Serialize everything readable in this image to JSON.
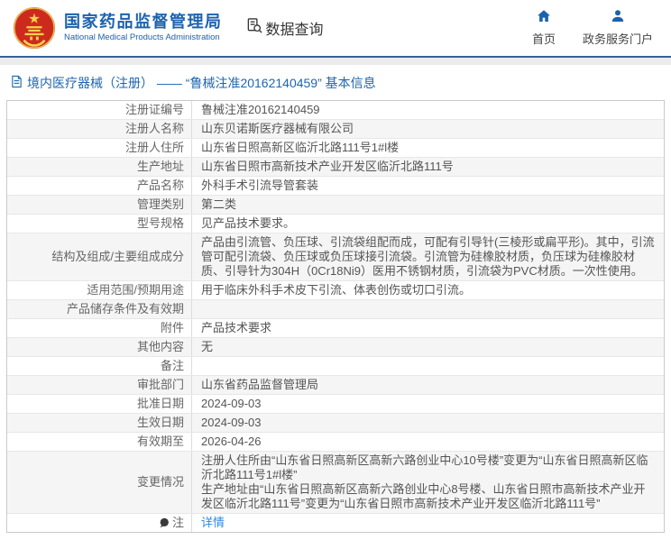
{
  "header": {
    "title_cn": "国家药品监督管理局",
    "title_en": "National Medical Products Administration",
    "data_query_label": "数据查询",
    "nav": [
      {
        "label": "首页",
        "icon": "home-icon"
      },
      {
        "label": "政务服务门户",
        "icon": "user-icon"
      }
    ]
  },
  "breadcrumb": {
    "text": "境内医疗器械（注册） —— “鲁械注准20162140459” 基本信息"
  },
  "table": {
    "rows": [
      {
        "label": "注册证编号",
        "value": "鲁械注准20162140459"
      },
      {
        "label": "注册人名称",
        "value": "山东贝诺斯医疗器械有限公司"
      },
      {
        "label": "注册人住所",
        "value": "山东省日照高新区临沂北路111号1#l楼"
      },
      {
        "label": "生产地址",
        "value": "山东省日照市高新技术产业开发区临沂北路111号"
      },
      {
        "label": "产品名称",
        "value": "外科手术引流导管套装"
      },
      {
        "label": "管理类别",
        "value": "第二类"
      },
      {
        "label": "型号规格",
        "value": "见产品技术要求。"
      },
      {
        "label": "结构及组成/主要组成成分",
        "value": "产品由引流管、负压球、引流袋组配而成，可配有引导针(三棱形或扁平形)。其中，引流管可配引流袋、负压球或负压球接引流袋。引流管为硅橡胶材质，负压球为硅橡胶材质、引导针为304H（0Cr18Ni9）医用不锈钢材质，引流袋为PVC材质。一次性使用。"
      },
      {
        "label": "适用范围/预期用途",
        "value": "用于临床外科手术皮下引流、体表创伤或切口引流。"
      },
      {
        "label": "产品储存条件及有效期",
        "value": ""
      },
      {
        "label": "附件",
        "value": "产品技术要求"
      },
      {
        "label": "其他内容",
        "value": "无"
      },
      {
        "label": "备注",
        "value": ""
      },
      {
        "label": "审批部门",
        "value": "山东省药品监督管理局"
      },
      {
        "label": "批准日期",
        "value": "2024-09-03"
      },
      {
        "label": "生效日期",
        "value": "2024-09-03"
      },
      {
        "label": "有效期至",
        "value": "2026-04-26"
      },
      {
        "label": "变更情况",
        "value": "注册人住所由“山东省日照高新区高新六路创业中心10号楼”变更为“山东省日照高新区临沂北路111号1#l楼”\n生产地址由“山东省日照高新区高新六路创业中心8号楼、山东省日照市高新技术产业开发区临沂北路111号”变更为“山东省日照市高新技术产业开发区临沂北路111号”"
      }
    ],
    "note_row": {
      "label": "注",
      "link": "详情"
    }
  },
  "colors": {
    "brand_blue": "#1b62ae",
    "header_line": "#31639c",
    "breadcrumb_blue": "#1d66b0",
    "link_blue": "#2e8ae6",
    "row_alt_bg": "#f5f5f5",
    "label_text": "#666666",
    "value_text": "#555555"
  }
}
